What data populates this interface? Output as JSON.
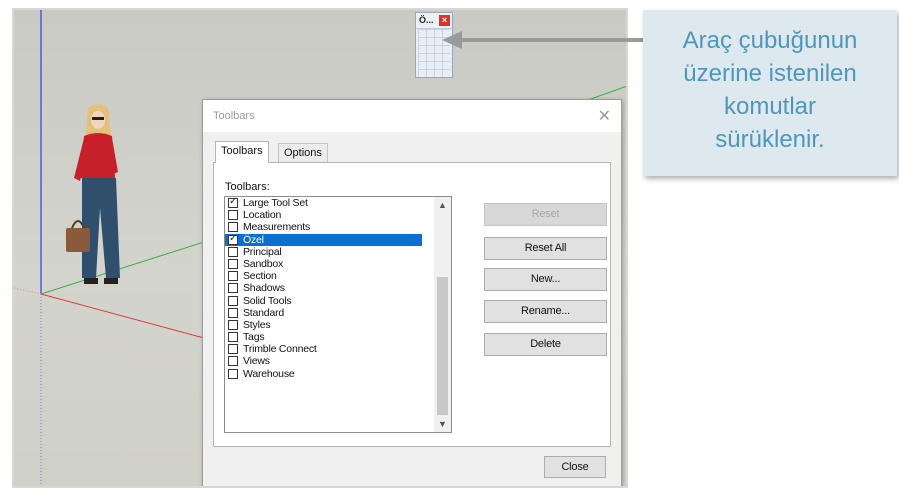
{
  "mini_toolbar": {
    "title": "Ö...",
    "close_symbol": "×"
  },
  "dialog": {
    "title": "Toolbars",
    "close_symbol": "✕",
    "tabs": [
      {
        "label": "Toolbars",
        "active": true
      },
      {
        "label": "Options",
        "active": false
      }
    ],
    "list_label": "Toolbars:",
    "toolbar_items": [
      {
        "label": "Large Tool Set",
        "checked": true,
        "selected": false
      },
      {
        "label": "Location",
        "checked": false,
        "selected": false
      },
      {
        "label": "Measurements",
        "checked": false,
        "selected": false
      },
      {
        "label": "Özel",
        "checked": true,
        "selected": true
      },
      {
        "label": "Principal",
        "checked": false,
        "selected": false
      },
      {
        "label": "Sandbox",
        "checked": false,
        "selected": false
      },
      {
        "label": "Section",
        "checked": false,
        "selected": false
      },
      {
        "label": "Shadows",
        "checked": false,
        "selected": false
      },
      {
        "label": "Solid Tools",
        "checked": false,
        "selected": false
      },
      {
        "label": "Standard",
        "checked": false,
        "selected": false
      },
      {
        "label": "Styles",
        "checked": false,
        "selected": false
      },
      {
        "label": "Tags",
        "checked": false,
        "selected": false
      },
      {
        "label": "Trimble Connect",
        "checked": false,
        "selected": false
      },
      {
        "label": "Views",
        "checked": false,
        "selected": false
      },
      {
        "label": "Warehouse",
        "checked": false,
        "selected": false
      }
    ],
    "buttons": {
      "reset": "Reset",
      "reset_all": "Reset All",
      "new": "New...",
      "rename": "Rename...",
      "delete": "Delete",
      "close": "Close"
    }
  },
  "callout": {
    "text": "Araç çubuğunun\nüzerine istenilen\nkomutlar\nsürüklenir."
  },
  "colors": {
    "selection": "#0a6fd1",
    "callout_text": "#4f97ba",
    "callout_bg": "#dee9ef",
    "axis_red": "#e03a3a",
    "axis_green": "#3cb043",
    "axis_blue": "#3b3bd6"
  }
}
